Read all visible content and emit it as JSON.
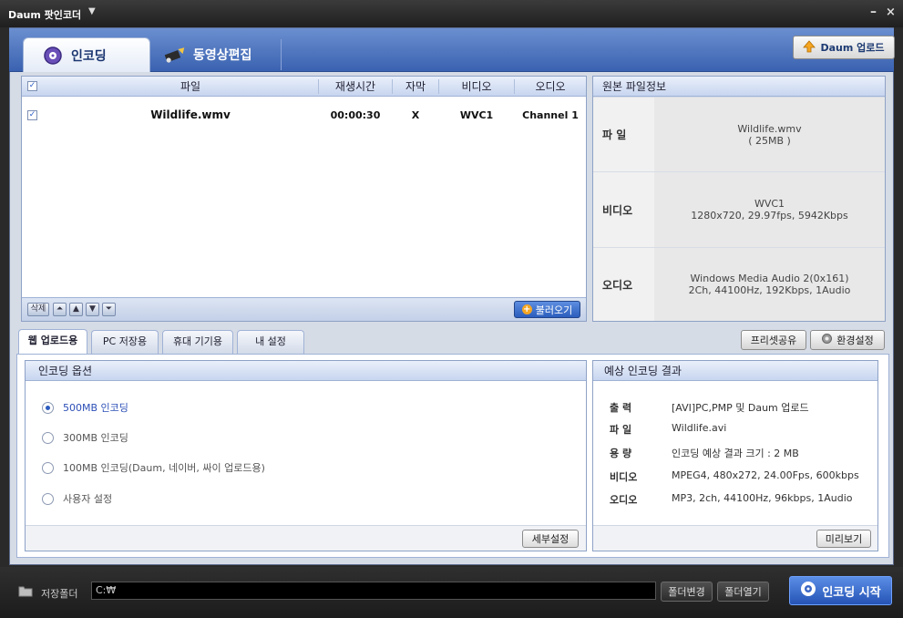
{
  "window": {
    "title": "Daum 팟인코더",
    "menu_arrow": "▼",
    "minimize": "–",
    "close": "×"
  },
  "header": {
    "tabs": [
      {
        "label": "인코딩",
        "icon": "encoding-disc-icon"
      },
      {
        "label": "동영상편집",
        "icon": "video-edit-icon"
      }
    ],
    "daum_upload": "Daum 업로드"
  },
  "file_list": {
    "columns": [
      "파일",
      "재생시간",
      "자막",
      "비디오",
      "오디오"
    ],
    "rows": [
      {
        "checked": true,
        "file": "Wildlife.wmv",
        "duration": "00:00:30",
        "subtitle": "X",
        "video": "WVC1",
        "audio": "Channel 1"
      }
    ],
    "toolbar": {
      "delete": "삭제",
      "top": "⏶",
      "up": "▲",
      "down": "▼",
      "bottom": "⏷",
      "load": "불러오기"
    }
  },
  "source_info": {
    "title": "원본 파일정보",
    "file_label": "파 일",
    "file_name": "Wildlife.wmv",
    "file_size": "( 25MB )",
    "video_label": "비디오",
    "video_codec": "WVC1",
    "video_detail": "1280x720, 29.97fps, 5942Kbps",
    "audio_label": "오디오",
    "audio_codec": "Windows Media Audio 2(0x161)",
    "audio_detail": "2Ch, 44100Hz, 192Kbps, 1Audio"
  },
  "lower_tabs": [
    "웹 업로드용",
    "PC 저장용",
    "휴대 기기용",
    "내 설정"
  ],
  "preset_share": "프리셋공유",
  "env_settings": "환경설정",
  "encoding_options": {
    "title": "인코딩 옵션",
    "options": [
      {
        "label": "500MB 인코딩",
        "selected": true
      },
      {
        "label": "300MB 인코딩",
        "selected": false
      },
      {
        "label": "100MB 인코딩(Daum, 네이버, 싸이 업로드용)",
        "selected": false
      },
      {
        "label": "사용자 설정",
        "selected": false
      }
    ],
    "detail_button": "세부설정"
  },
  "expected_result": {
    "title": "예상 인코딩 결과",
    "rows": [
      {
        "k": "출 력",
        "v": "[AVI]PC,PMP 및 Daum 업로드"
      },
      {
        "k": "파 일",
        "v": "Wildlife.avi"
      },
      {
        "k": "용 량",
        "v": "인코딩 예상 결과 크기 : 2 MB"
      },
      {
        "k": "비디오",
        "v": "MPEG4, 480x272, 24.00Fps, 600kbps"
      },
      {
        "k": "오디오",
        "v": "MP3, 2ch, 44100Hz, 96kbps, 1Audio"
      }
    ],
    "preview_button": "미리보기"
  },
  "bottom": {
    "folder_label": "저장폴더",
    "folder_path": "C:₩",
    "change_folder": "폴더변경",
    "open_folder": "폴더열기",
    "start_encoding": "인코딩 시작"
  }
}
